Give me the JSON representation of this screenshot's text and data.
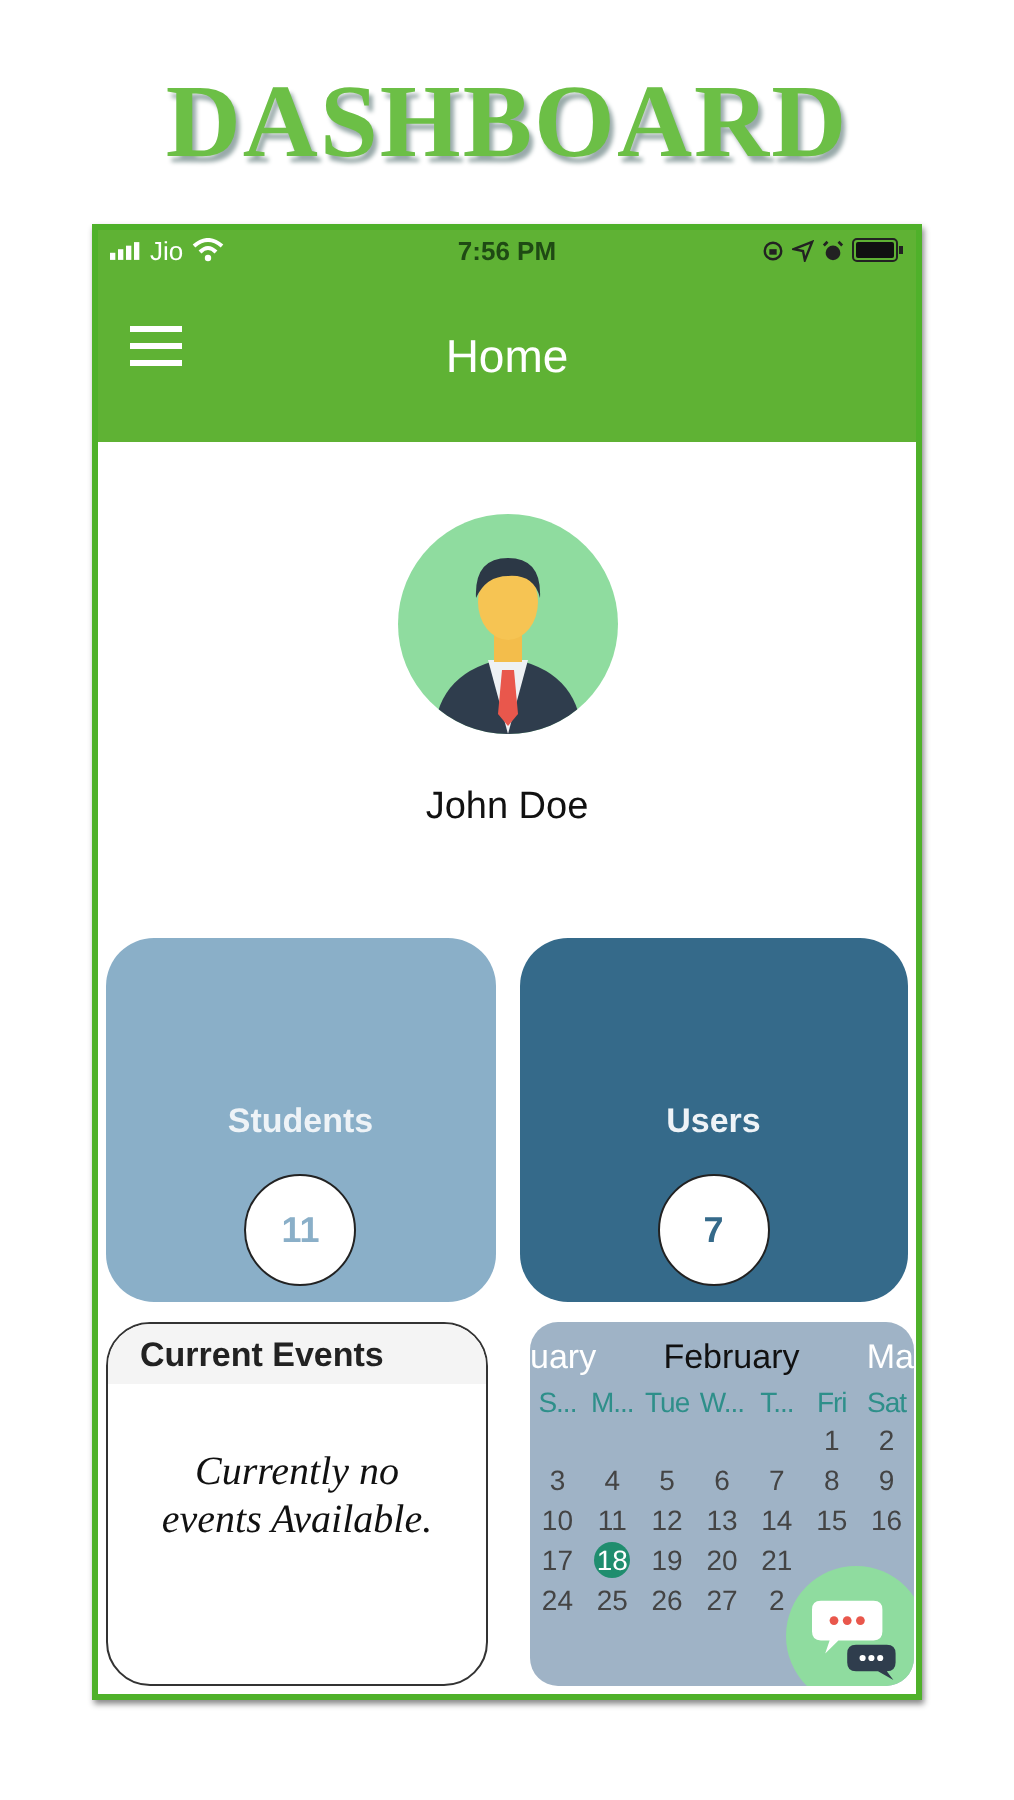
{
  "heading": "DASHBOARD",
  "status_bar": {
    "carrier": "Jio",
    "time": "7:56 PM"
  },
  "app_bar": {
    "title": "Home"
  },
  "profile": {
    "name": "John Doe"
  },
  "stat_cards": [
    {
      "label": "Students",
      "count": "11",
      "color": "#8aafc8"
    },
    {
      "label": "Users",
      "count": "7",
      "color": "#356a8a"
    }
  ],
  "events": {
    "title": "Current Events",
    "message": "Currently no events Available."
  },
  "calendar": {
    "previous_month": "uary",
    "month": "February",
    "next_month": "Ma",
    "weekdays": [
      "S...",
      "M...",
      "Tue",
      "W...",
      "T...",
      "Fri",
      "Sat"
    ],
    "days": [
      {
        "label": "1",
        "selected": false
      },
      {
        "label": "2",
        "selected": false
      },
      {
        "label": "3",
        "selected": false
      },
      {
        "label": "4",
        "selected": false
      },
      {
        "label": "5",
        "selected": false
      },
      {
        "label": "6",
        "selected": false
      },
      {
        "label": "7",
        "selected": false
      },
      {
        "label": "8",
        "selected": false
      },
      {
        "label": "9",
        "selected": false
      },
      {
        "label": "10",
        "selected": false
      },
      {
        "label": "11",
        "selected": false
      },
      {
        "label": "12",
        "selected": false
      },
      {
        "label": "13",
        "selected": false
      },
      {
        "label": "14",
        "selected": false
      },
      {
        "label": "15",
        "selected": false
      },
      {
        "label": "16",
        "selected": false
      },
      {
        "label": "17",
        "selected": false
      },
      {
        "label": "18",
        "selected": true
      },
      {
        "label": "19",
        "selected": false
      },
      {
        "label": "20",
        "selected": false
      },
      {
        "label": "21",
        "selected": false
      },
      {
        "label": "24",
        "selected": false
      },
      {
        "label": "25",
        "selected": false
      },
      {
        "label": "26",
        "selected": false
      },
      {
        "label": "27",
        "selected": false
      },
      {
        "label": "2",
        "selected": false
      }
    ]
  }
}
